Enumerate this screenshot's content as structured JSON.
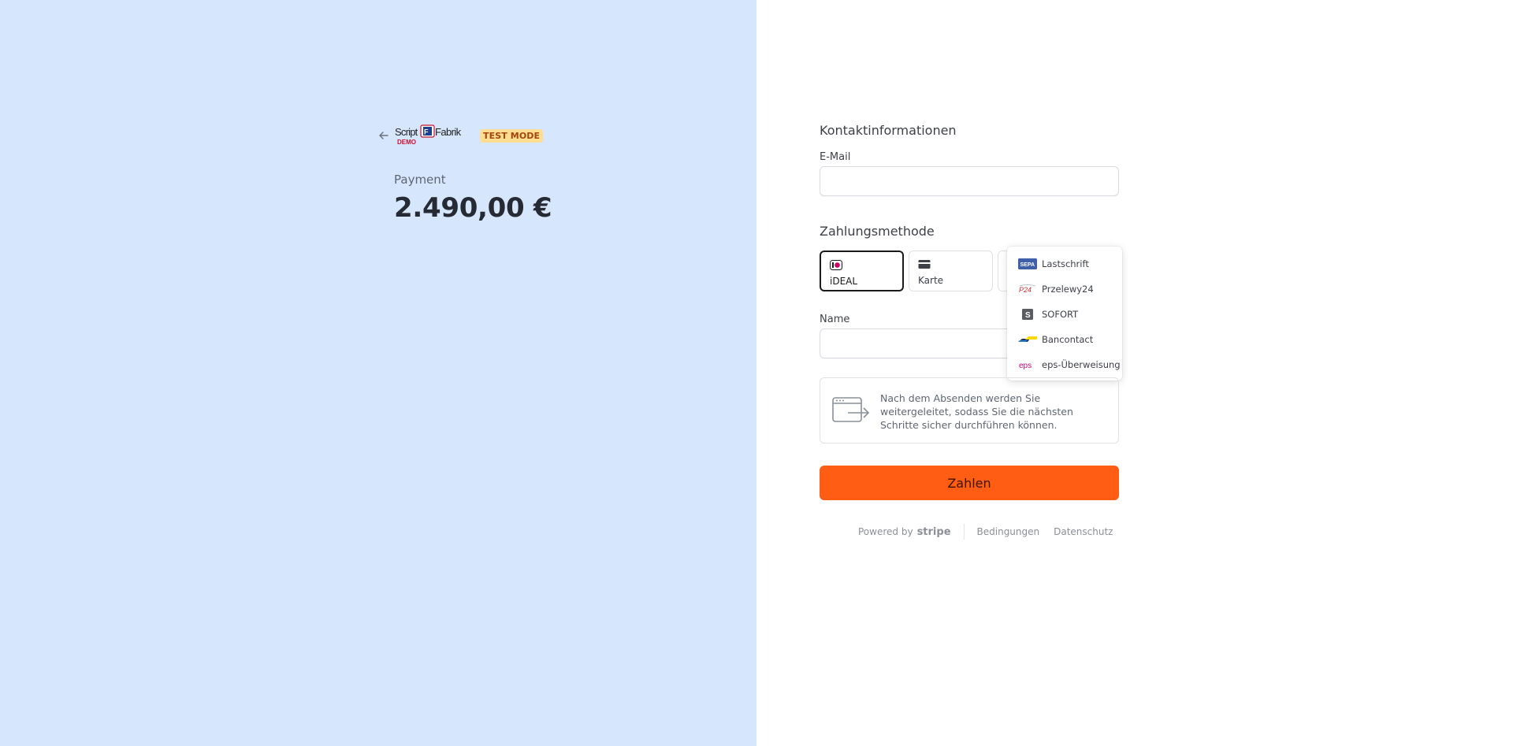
{
  "brand": {
    "logo_text": "ScriptFabrik",
    "logo_demo": "DEMO",
    "test_badge": "TEST MODE"
  },
  "summary": {
    "label": "Payment",
    "amount": "2.490,00 €"
  },
  "contact": {
    "title": "Kontaktinformationen",
    "email_label": "E-Mail",
    "email_value": "",
    "email_placeholder": ""
  },
  "payment": {
    "title": "Zahlungsmethode",
    "methods": [
      {
        "label": "iDEAL",
        "icon": "ideal-icon",
        "selected": true
      },
      {
        "label": "Karte",
        "icon": "card-icon",
        "selected": false
      }
    ],
    "dropdown_items": [
      {
        "label": "Lastschrift",
        "icon": "sepa-icon"
      },
      {
        "label": "Przelewy24",
        "icon": "p24-icon"
      },
      {
        "label": "SOFORT",
        "icon": "sofort-icon"
      },
      {
        "label": "Bancontact",
        "icon": "bancontact-icon"
      },
      {
        "label": "eps-Überweisung",
        "icon": "eps-icon"
      }
    ],
    "name_label": "Name",
    "name_value": "",
    "redirect_info": "Nach dem Absenden werden Sie weitergeleitet, sodass Sie die nächsten Schritte sicher durchführen können."
  },
  "actions": {
    "pay_label": "Zahlen"
  },
  "footer": {
    "powered_by": "Powered by",
    "stripe": "stripe",
    "terms": "Bedingungen",
    "privacy": "Datenschutz"
  },
  "colors": {
    "left_bg": "#d6e6fd",
    "accent": "#ff5d14",
    "badge_bg": "#ffde92"
  }
}
